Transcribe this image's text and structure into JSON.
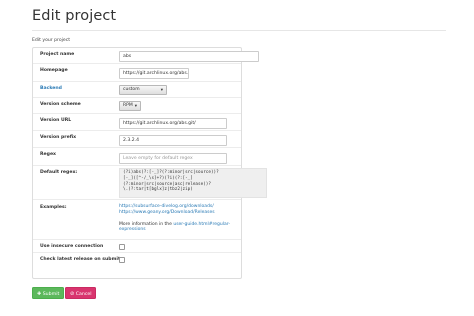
{
  "page": {
    "title": "Edit project",
    "subtitle": "Edit your project"
  },
  "form": {
    "project_name": {
      "label": "Project name",
      "value": "abs"
    },
    "homepage": {
      "label": "Homepage",
      "value": "https://git.archlinux.org/abs."
    },
    "backend": {
      "label": "Backend",
      "selected": "custom"
    },
    "version_scheme": {
      "label": "Version scheme",
      "selected": "RPM"
    },
    "version_url": {
      "label": "Version URL",
      "value": "https://git.archlinux.org/abs.git/"
    },
    "version_prefix": {
      "label": "Version prefix",
      "value": "2.3.2.4"
    },
    "regex": {
      "label": "Regex",
      "placeholder": "Leave empty for default regex"
    },
    "default_regex": {
      "label": "Default regex:",
      "lines": [
        "(?i)abs(?:[-_]?(?:minor|src|source))?",
        "[-_]([^-/_\\s]+?)(?i)(?:[-_]",
        "(?:minor|src|source|asc|release))?",
        "\\.(?:tar|t[bglx]z|tbz2|zip)"
      ]
    },
    "examples": {
      "label": "Examples:",
      "links": [
        "https://subsurface-divelog.org/downloads/",
        "https://www.geany.org/Download/Releases"
      ],
      "more_prefix": "More information in the ",
      "more_link": "user-guide.html#regular-",
      "more_link_cont": "expressions"
    },
    "insecure": {
      "label": "Use insecure connection",
      "checked": false
    },
    "check_latest": {
      "label": "Check latest release on submit",
      "checked": false
    }
  },
  "buttons": {
    "submit": "Submit",
    "cancel": "Cancel"
  },
  "colors": {
    "submit": "#5cb85c",
    "cancel": "#d9346e",
    "link": "#2a7ab5"
  }
}
